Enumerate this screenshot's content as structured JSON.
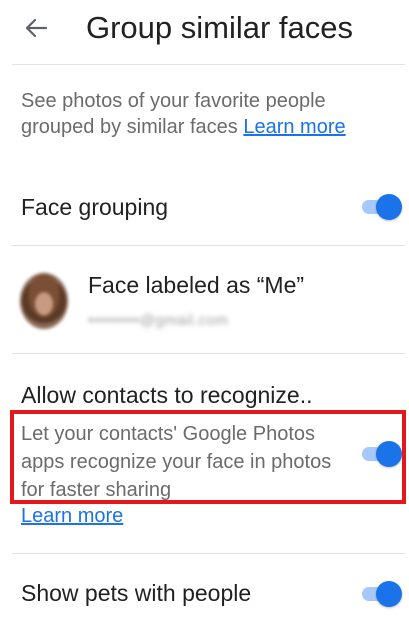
{
  "header": {
    "back_icon": "arrow-back-icon",
    "title": "Group similar faces"
  },
  "description": {
    "text": "See photos of your favorite people grouped by similar faces",
    "link": "Learn more"
  },
  "face_grouping": {
    "label": "Face grouping",
    "enabled": true
  },
  "face_label": {
    "title": "Face labeled as “Me”",
    "email": "•••••••••@gmail.com"
  },
  "contacts": {
    "title": "Allow contacts to recognize..",
    "description": "Let your contacts' Google Photos apps recognize your face in photos for faster sharing",
    "link": "Learn more",
    "enabled": true
  },
  "pets": {
    "label": "Show pets with people",
    "enabled": true
  },
  "colors": {
    "accent": "#1a73e8",
    "toggle_track": "#a8c7fa",
    "highlight": "#e3181d"
  }
}
